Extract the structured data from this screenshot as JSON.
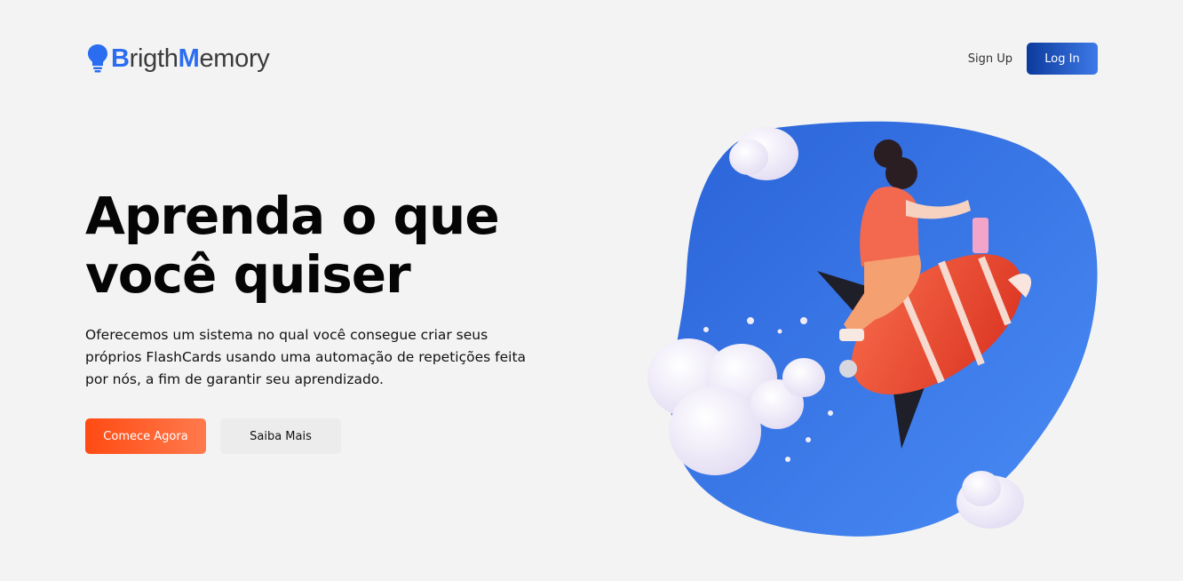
{
  "header": {
    "logo": {
      "part1": "B",
      "part2": "rigth",
      "part3": "M",
      "part4": "emory"
    },
    "nav": {
      "signup_label": "Sign Up",
      "login_label": "Log In"
    }
  },
  "hero": {
    "title_line1": "Aprenda o que",
    "title_line2": "você quiser",
    "description": "Oferecemos um sistema no qual você consegue criar seus próprios FlashCards usando uma automação de repetições feita por nós, a fim de garantir seu aprendizado.",
    "primary_button": "Comece Agora",
    "secondary_button": "Saiba Mais"
  },
  "colors": {
    "brand_blue": "#2a6df1",
    "login_gradient": [
      "#0c3a9c",
      "#3e7ae8"
    ],
    "primary_gradient": [
      "#ff4b13",
      "#ff7a4d"
    ],
    "background": "#f3f3f3"
  },
  "icons": {
    "logo": "lightbulb-icon"
  }
}
